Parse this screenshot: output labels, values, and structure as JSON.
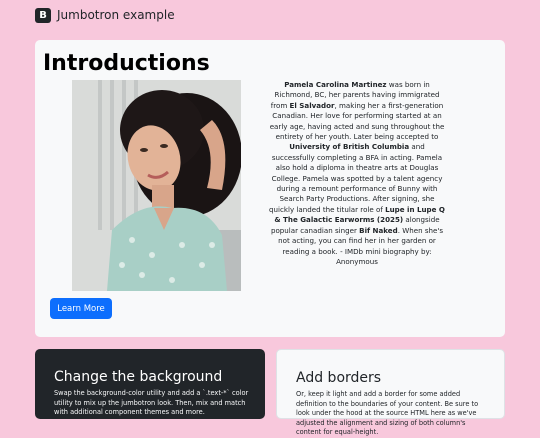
{
  "navbar": {
    "logo_letter": "B",
    "title": "Jumbotron example"
  },
  "jumbotron": {
    "title": "Introductions",
    "bio": {
      "p1": "Pamela Carolina Martinez",
      "p2": " was born in Richmond, BC, her parents having immigrated from ",
      "p3": "El Salvador",
      "p4": ", making her a first-generation Canadian. Her love for performing started at an early age, having acted and sung throughout the entirety of her youth. Later being accepted to ",
      "p5": "University of British Columbia",
      "p6": " and successfully completing a BFA in acting. Pamela also hold a diploma in theatre arts at Douglas College. Pamela was spotted by a talent agency during a remount performance of Bunny with Search Party Productions. After signing, she quickly landed the titular role of ",
      "p7": "Lupe in Lupe Q & The Galactic Earworms (2025)",
      "p8": " alongside popular canadian singer ",
      "p9": "Bif Naked",
      "p10": ". When she's not acting, you can find her in her garden or reading a book. - IMDb mini biography by: Anonymous"
    },
    "button_label": "Learn More",
    "button_color": "#0d6efd"
  },
  "cards": {
    "dark": {
      "title": "Change the background",
      "text": "Swap the background-color utility and add a `.text-*` color utility to mix up the jumbotron look. Then, mix and match with additional component themes and more."
    },
    "light": {
      "title": "Add borders",
      "text": "Or, keep it light and add a border for some added definition to the boundaries of your content. Be sure to look under the hood at the source HTML here as we've adjusted the alignment and sizing of both column's content for equal-height."
    }
  },
  "colors": {
    "page_background": "#f8c8dc",
    "panel_background": "#f8f9fa",
    "dark_card": "#212529"
  }
}
